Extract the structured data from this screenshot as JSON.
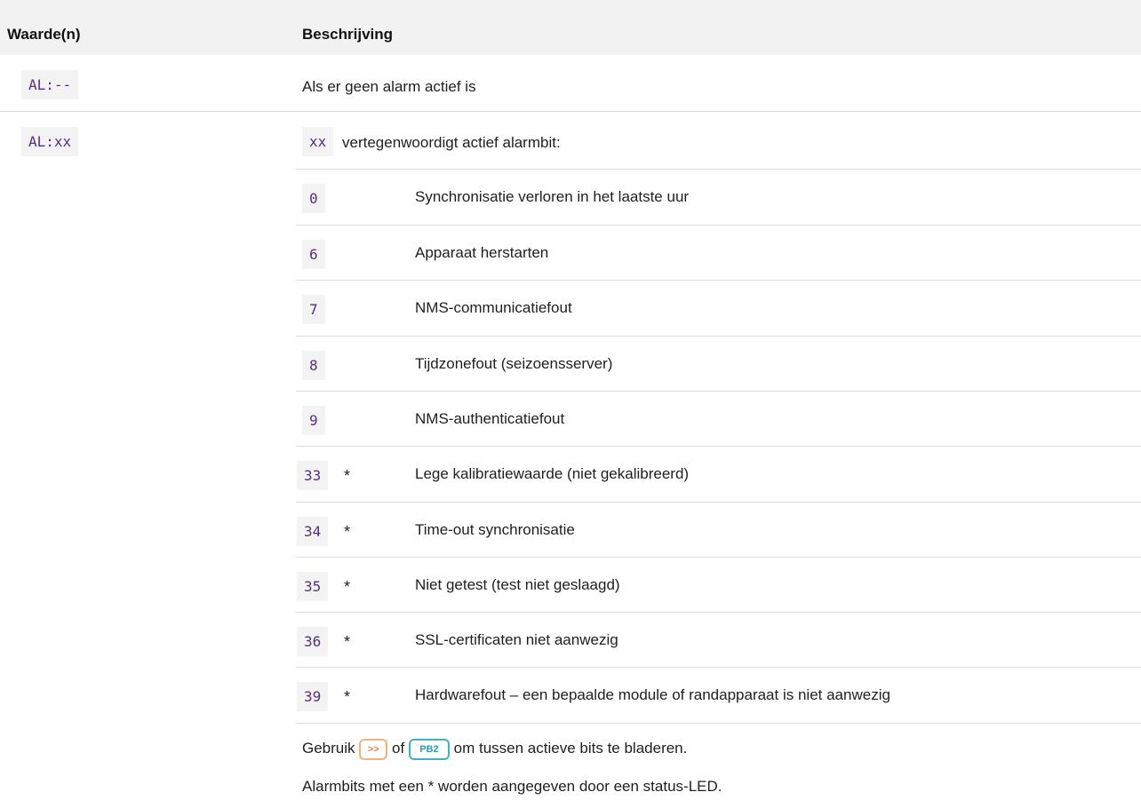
{
  "header": {
    "col1": "Waarde(n)",
    "col2": "Beschrijving"
  },
  "rows": [
    {
      "value": "AL:--",
      "description": "Als er geen alarm actief is"
    },
    {
      "value": "AL:xx",
      "intro_code": "xx",
      "intro_text": "vertegenwoordigt actief alarmbit:"
    }
  ],
  "alarm_bits": [
    {
      "bit": "0",
      "star": "",
      "description": "Synchronisatie verloren in het laatste uur"
    },
    {
      "bit": "6",
      "star": "",
      "description": "Apparaat herstarten"
    },
    {
      "bit": "7",
      "star": "",
      "description": "NMS-communicatiefout"
    },
    {
      "bit": "8",
      "star": "",
      "description": "Tijdzonefout (seizoensserver)"
    },
    {
      "bit": "9",
      "star": "",
      "description": "NMS-authenticatiefout"
    },
    {
      "bit": "33",
      "star": "*",
      "description": "Lege kalibratiewaarde (niet gekalibreerd)"
    },
    {
      "bit": "34",
      "star": "*",
      "description": "Time-out synchronisatie"
    },
    {
      "bit": "35",
      "star": "*",
      "description": "Niet getest (test niet geslaagd)"
    },
    {
      "bit": "36",
      "star": "*",
      "description": "SSL-certificaten niet aanwezig"
    },
    {
      "bit": "39",
      "star": "*",
      "description": "Hardwarefout – een bepaalde module of randapparaat is niet aanwezig"
    }
  ],
  "footer": {
    "browse_prefix": "Gebruik",
    "button1": ">>",
    "browse_or": "of",
    "button2": "PB2",
    "browse_suffix": "om tussen actieve bits te bladeren.",
    "note": "Alarmbits met een * worden aangegeven door een status-LED."
  },
  "colors": {
    "code_text": "#5a2d88",
    "code_bg": "#f3f3f3",
    "button1_accent": "#e0854b",
    "button2_accent": "#2a9fb3"
  }
}
